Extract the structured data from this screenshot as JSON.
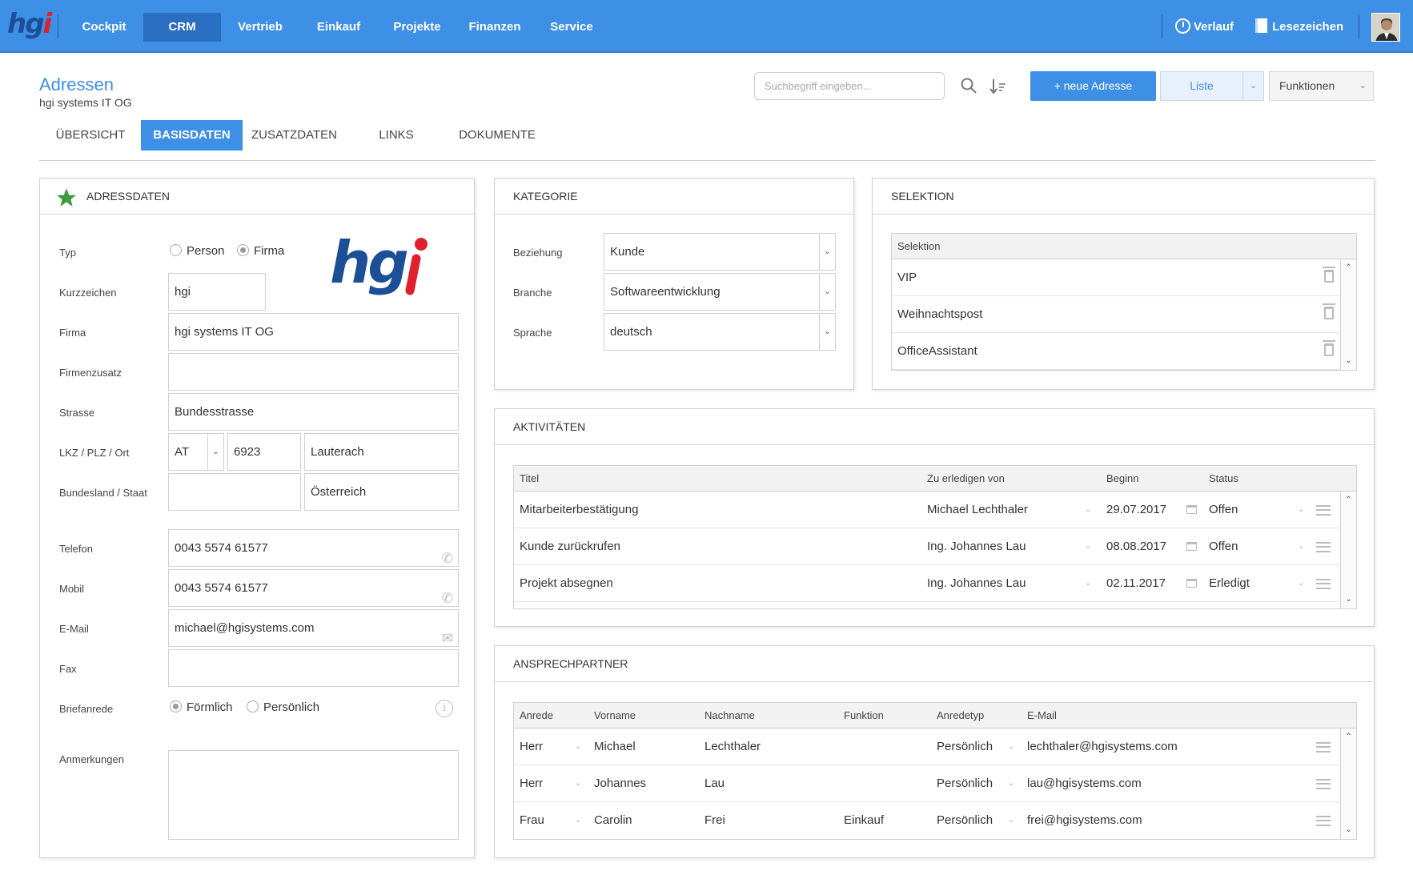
{
  "app": {
    "logo": "hgi"
  },
  "nav": {
    "items": [
      "Cockpit",
      "CRM",
      "Vertrieb",
      "Einkauf",
      "Projekte",
      "Finanzen",
      "Service"
    ],
    "active": "CRM",
    "history": "Verlauf",
    "bookmarks": "Lesezeichen"
  },
  "header": {
    "title": "Adressen",
    "subtitle": "hgi systems IT OG",
    "search_placeholder": "Suchbegriff eingeben...",
    "new_button": "+ neue Adresse",
    "list_button": "Liste",
    "functions_button": "Funktionen"
  },
  "tabs": [
    "ÜBERSICHT",
    "BASISDATEN",
    "ZUSATZDATEN",
    "LINKS",
    "DOKUMENTE"
  ],
  "active_tab": "BASISDATEN",
  "colors": {
    "accent": "#3e8fe6",
    "logo_blue": "#1d4f99",
    "logo_red": "#e0202c",
    "star": "#3d9a3d"
  },
  "address": {
    "heading": "ADRESSDATEN",
    "labels": {
      "typ": "Typ",
      "kurzzeichen": "Kurzzeichen",
      "firma": "Firma",
      "firmenzusatz": "Firmenzusatz",
      "strasse": "Strasse",
      "lkz": "LKZ / PLZ / Ort",
      "bundesland": "Bundesland / Staat",
      "telefon": "Telefon",
      "mobil": "Mobil",
      "email": "E-Mail",
      "fax": "Fax",
      "briefanrede": "Briefanrede",
      "anmerkungen": "Anmerkungen"
    },
    "typ_options": [
      "Person",
      "Firma"
    ],
    "typ_selected": "Firma",
    "kurzzeichen": "hgi",
    "firma": "hgi systems IT OG",
    "firmenzusatz": "",
    "strasse": "Bundesstrasse",
    "lkz": "AT",
    "plz": "6923",
    "ort": "Lauterach",
    "bundesland": "",
    "staat": "Österreich",
    "telefon": "0043 5574 61577",
    "mobil": "0043 5574 61577",
    "email": "michael@hgisystems.com",
    "fax": "",
    "briefanrede_options": [
      "Förmlich",
      "Persönlich"
    ],
    "briefanrede_selected": "Förmlich",
    "anmerkungen": ""
  },
  "category": {
    "heading": "KATEGORIE",
    "labels": {
      "beziehung": "Beziehung",
      "branche": "Branche",
      "sprache": "Sprache"
    },
    "beziehung": "Kunde",
    "branche": "Softwareentwicklung",
    "sprache": "deutsch"
  },
  "selection": {
    "heading": "SELEKTION",
    "column": "Selektion",
    "items": [
      "VIP",
      "Weihnachtspost",
      "OfficeAssistant"
    ]
  },
  "activities": {
    "heading": "AKTIVITÄTEN",
    "columns": [
      "Titel",
      "Zu erledigen von",
      "Beginn",
      "Status"
    ],
    "rows": [
      {
        "titel": "Mitarbeiterbestätigung",
        "person": "Michael Lechthaler",
        "beginn": "29.07.2017",
        "status": "Offen"
      },
      {
        "titel": "Kunde zurückrufen",
        "person": "Ing. Johannes Lau",
        "beginn": "08.08.2017",
        "status": "Offen"
      },
      {
        "titel": "Projekt absegnen",
        "person": "Ing. Johannes Lau",
        "beginn": "02.11.2017",
        "status": "Erledigt"
      }
    ]
  },
  "contacts": {
    "heading": "ANSPRECHPARTNER",
    "columns": [
      "Anrede",
      "Vorname",
      "Nachname",
      "Funktion",
      "Anredetyp",
      "E-Mail"
    ],
    "rows": [
      {
        "anrede": "Herr",
        "vorname": "Michael",
        "nachname": "Lechthaler",
        "funktion": "",
        "anredetyp": "Persönlich",
        "email": "lechthaler@hgisystems.com"
      },
      {
        "anrede": "Herr",
        "vorname": "Johannes",
        "nachname": "Lau",
        "funktion": "",
        "anredetyp": "Persönlich",
        "email": "lau@hgisystems.com"
      },
      {
        "anrede": "Frau",
        "vorname": "Carolin",
        "nachname": "Frei",
        "funktion": "Einkauf",
        "anredetyp": "Persönlich",
        "email": "frei@hgisystems.com"
      }
    ]
  }
}
